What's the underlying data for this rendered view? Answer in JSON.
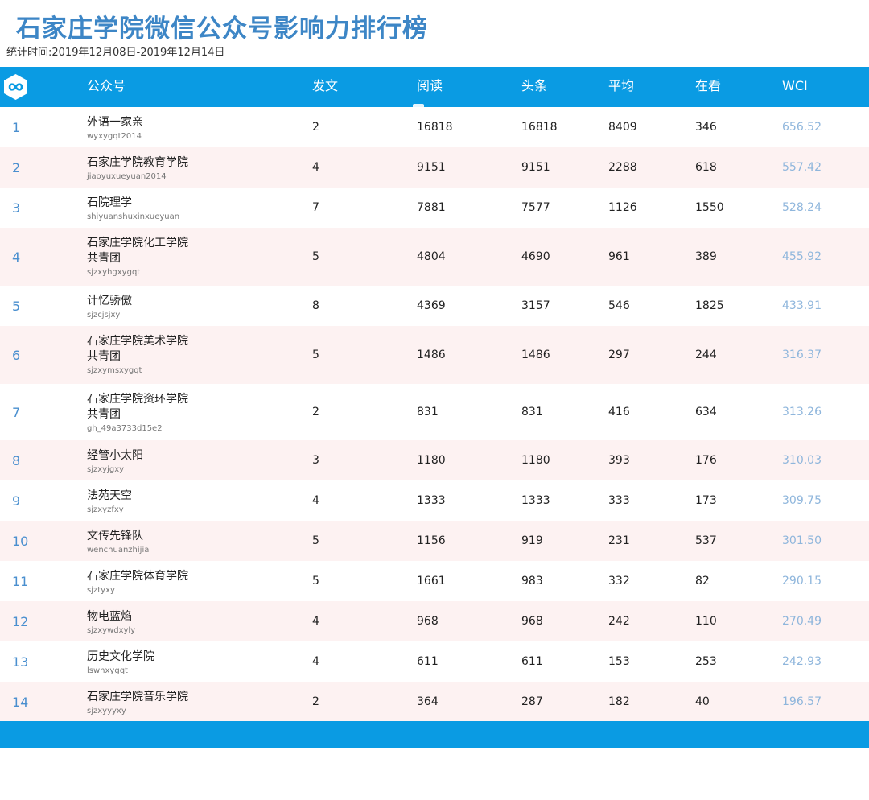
{
  "title": "石家庄学院微信公众号影响力排行榜",
  "subtitle": "统计时间:2019年12月08日-2019年12月14日",
  "colors": {
    "brand_blue": "#0a9be3",
    "title_blue": "#3d86c6",
    "rank_blue": "#4a8fcf",
    "wci_blue": "#8fb6dc",
    "alt_row": "#fdf2f2"
  },
  "logo_icon": "infinity-link-icon",
  "headers": {
    "account": "公众号",
    "posts": "发文",
    "reads": "阅读",
    "headline": "头条",
    "average": "平均",
    "watching": "在看",
    "wci": "WCI"
  },
  "rows": [
    {
      "rank": "1",
      "name": "外语一家亲",
      "account": "wyxygqt2014",
      "posts": "2",
      "reads": "16818",
      "headline": "16818",
      "average": "8409",
      "watching": "346",
      "wci": "656.52"
    },
    {
      "rank": "2",
      "name": "石家庄学院教育学院",
      "account": "jiaoyuxueyuan2014",
      "posts": "4",
      "reads": "9151",
      "headline": "9151",
      "average": "2288",
      "watching": "618",
      "wci": "557.42"
    },
    {
      "rank": "3",
      "name": "石院理学",
      "account": "shiyuanshuxinxueyuan",
      "posts": "7",
      "reads": "7881",
      "headline": "7577",
      "average": "1126",
      "watching": "1550",
      "wci": "528.24"
    },
    {
      "rank": "4",
      "name": "石家庄学院化工学院\n共青团",
      "account": "sjzxyhgxygqt",
      "posts": "5",
      "reads": "4804",
      "headline": "4690",
      "average": "961",
      "watching": "389",
      "wci": "455.92"
    },
    {
      "rank": "5",
      "name": "计忆骄傲",
      "account": "sjzcjsjxy",
      "posts": "8",
      "reads": "4369",
      "headline": "3157",
      "average": "546",
      "watching": "1825",
      "wci": "433.91"
    },
    {
      "rank": "6",
      "name": "石家庄学院美术学院\n共青团",
      "account": "sjzxymsxygqt",
      "posts": "5",
      "reads": "1486",
      "headline": "1486",
      "average": "297",
      "watching": "244",
      "wci": "316.37"
    },
    {
      "rank": "7",
      "name": "石家庄学院资环学院\n共青团",
      "account": "gh_49a3733d15e2",
      "posts": "2",
      "reads": "831",
      "headline": "831",
      "average": "416",
      "watching": "634",
      "wci": "313.26"
    },
    {
      "rank": "8",
      "name": "经管小太阳",
      "account": "sjzxyjgxy",
      "posts": "3",
      "reads": "1180",
      "headline": "1180",
      "average": "393",
      "watching": "176",
      "wci": "310.03"
    },
    {
      "rank": "9",
      "name": "法苑天空",
      "account": "sjzxyzfxy",
      "posts": "4",
      "reads": "1333",
      "headline": "1333",
      "average": "333",
      "watching": "173",
      "wci": "309.75"
    },
    {
      "rank": "10",
      "name": "文传先锋队",
      "account": "wenchuanzhijia",
      "posts": "5",
      "reads": "1156",
      "headline": "919",
      "average": "231",
      "watching": "537",
      "wci": "301.50"
    },
    {
      "rank": "11",
      "name": "石家庄学院体育学院",
      "account": "sjztyxy",
      "posts": "5",
      "reads": "1661",
      "headline": "983",
      "average": "332",
      "watching": "82",
      "wci": "290.15"
    },
    {
      "rank": "12",
      "name": "物电蓝焰",
      "account": "sjzxywdxyly",
      "posts": "4",
      "reads": "968",
      "headline": "968",
      "average": "242",
      "watching": "110",
      "wci": "270.49"
    },
    {
      "rank": "13",
      "name": "历史文化学院",
      "account": "lswhxygqt",
      "posts": "4",
      "reads": "611",
      "headline": "611",
      "average": "153",
      "watching": "253",
      "wci": "242.93"
    },
    {
      "rank": "14",
      "name": "石家庄学院音乐学院",
      "account": "sjzxyyyxy",
      "posts": "2",
      "reads": "364",
      "headline": "287",
      "average": "182",
      "watching": "40",
      "wci": "196.57"
    }
  ]
}
